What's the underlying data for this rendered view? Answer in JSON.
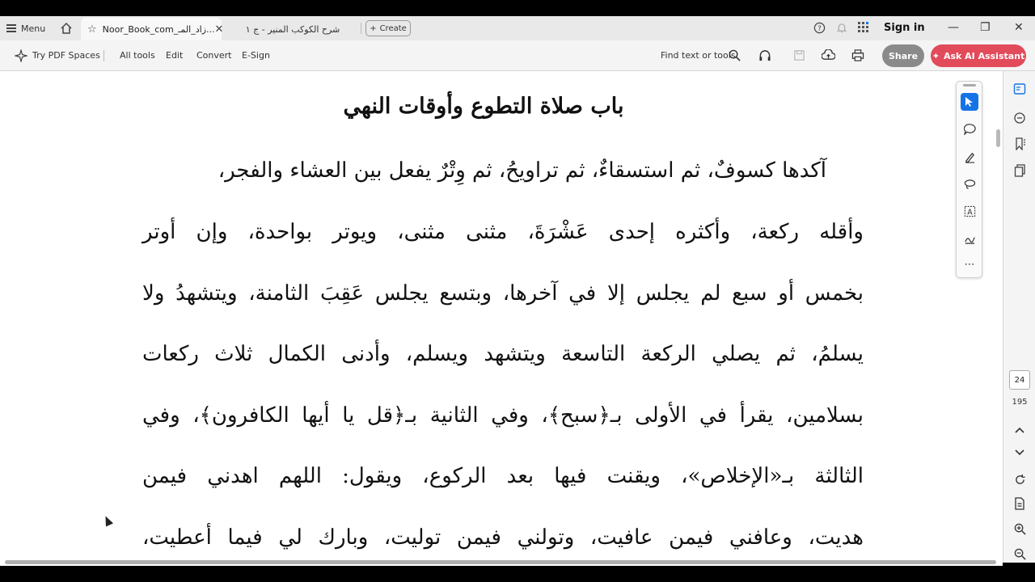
{
  "app": {
    "menu_label": "Menu",
    "tabs": [
      {
        "label": "Noor_Book_com_زاد_المـ..."
      },
      {
        "label": "شرح الكوكب المنير - ج ١"
      }
    ],
    "create_label": "Create",
    "sign_in": "Sign in"
  },
  "toolbar": {
    "try_pdf_spaces": "Try PDF Spaces",
    "all_tools": "All tools",
    "edit": "Edit",
    "convert": "Convert",
    "esign": "E-Sign",
    "find": "Find text or tools",
    "share": "Share",
    "ai_assistant": "Ask AI Assistant"
  },
  "document": {
    "heading": "باب صلاة التطوع وأوقات النهي",
    "lines": [
      "آكدها كسوفٌ، ثم استسقاءٌ، ثم تراويحُ، ثم وِتْرٌ يفعل بين العشاء والفجر،",
      "وأقله ركعة، وأكثره إحدى عَشْرَةَ، مثنى مثنى، ويوتر بواحدة، وإن أوتر",
      "بخمس أو سبع لم يجلس إلا في آخرها، وبتسع يجلس عَقِبَ الثامنة، ويتشهدُ ولا",
      "يسلمُ، ثم يصلي الركعة التاسعة ويتشهد ويسلم، وأدنى الكمال ثلاث ركعات",
      "بسلامين، يقرأ في الأولى بـ﴿سبح﴾، وفي الثانية بـ﴿قل يا أيها الكافرون﴾، وفي",
      "الثالثة بـ«الإخلاص»، ويقنت فيها بعد الركوع، ويقول: اللهم اهدني فيمن",
      "هديت، وعافني فيمن عافيت، وتولني فيمن توليت، وبارك لي فيما أعطيت،"
    ]
  },
  "navigation": {
    "current_page": "24",
    "total_pages": "195"
  },
  "colors": {
    "accent": "#1473e6",
    "ai_button": "#e24b5a",
    "share_button": "#8a8a8a"
  }
}
